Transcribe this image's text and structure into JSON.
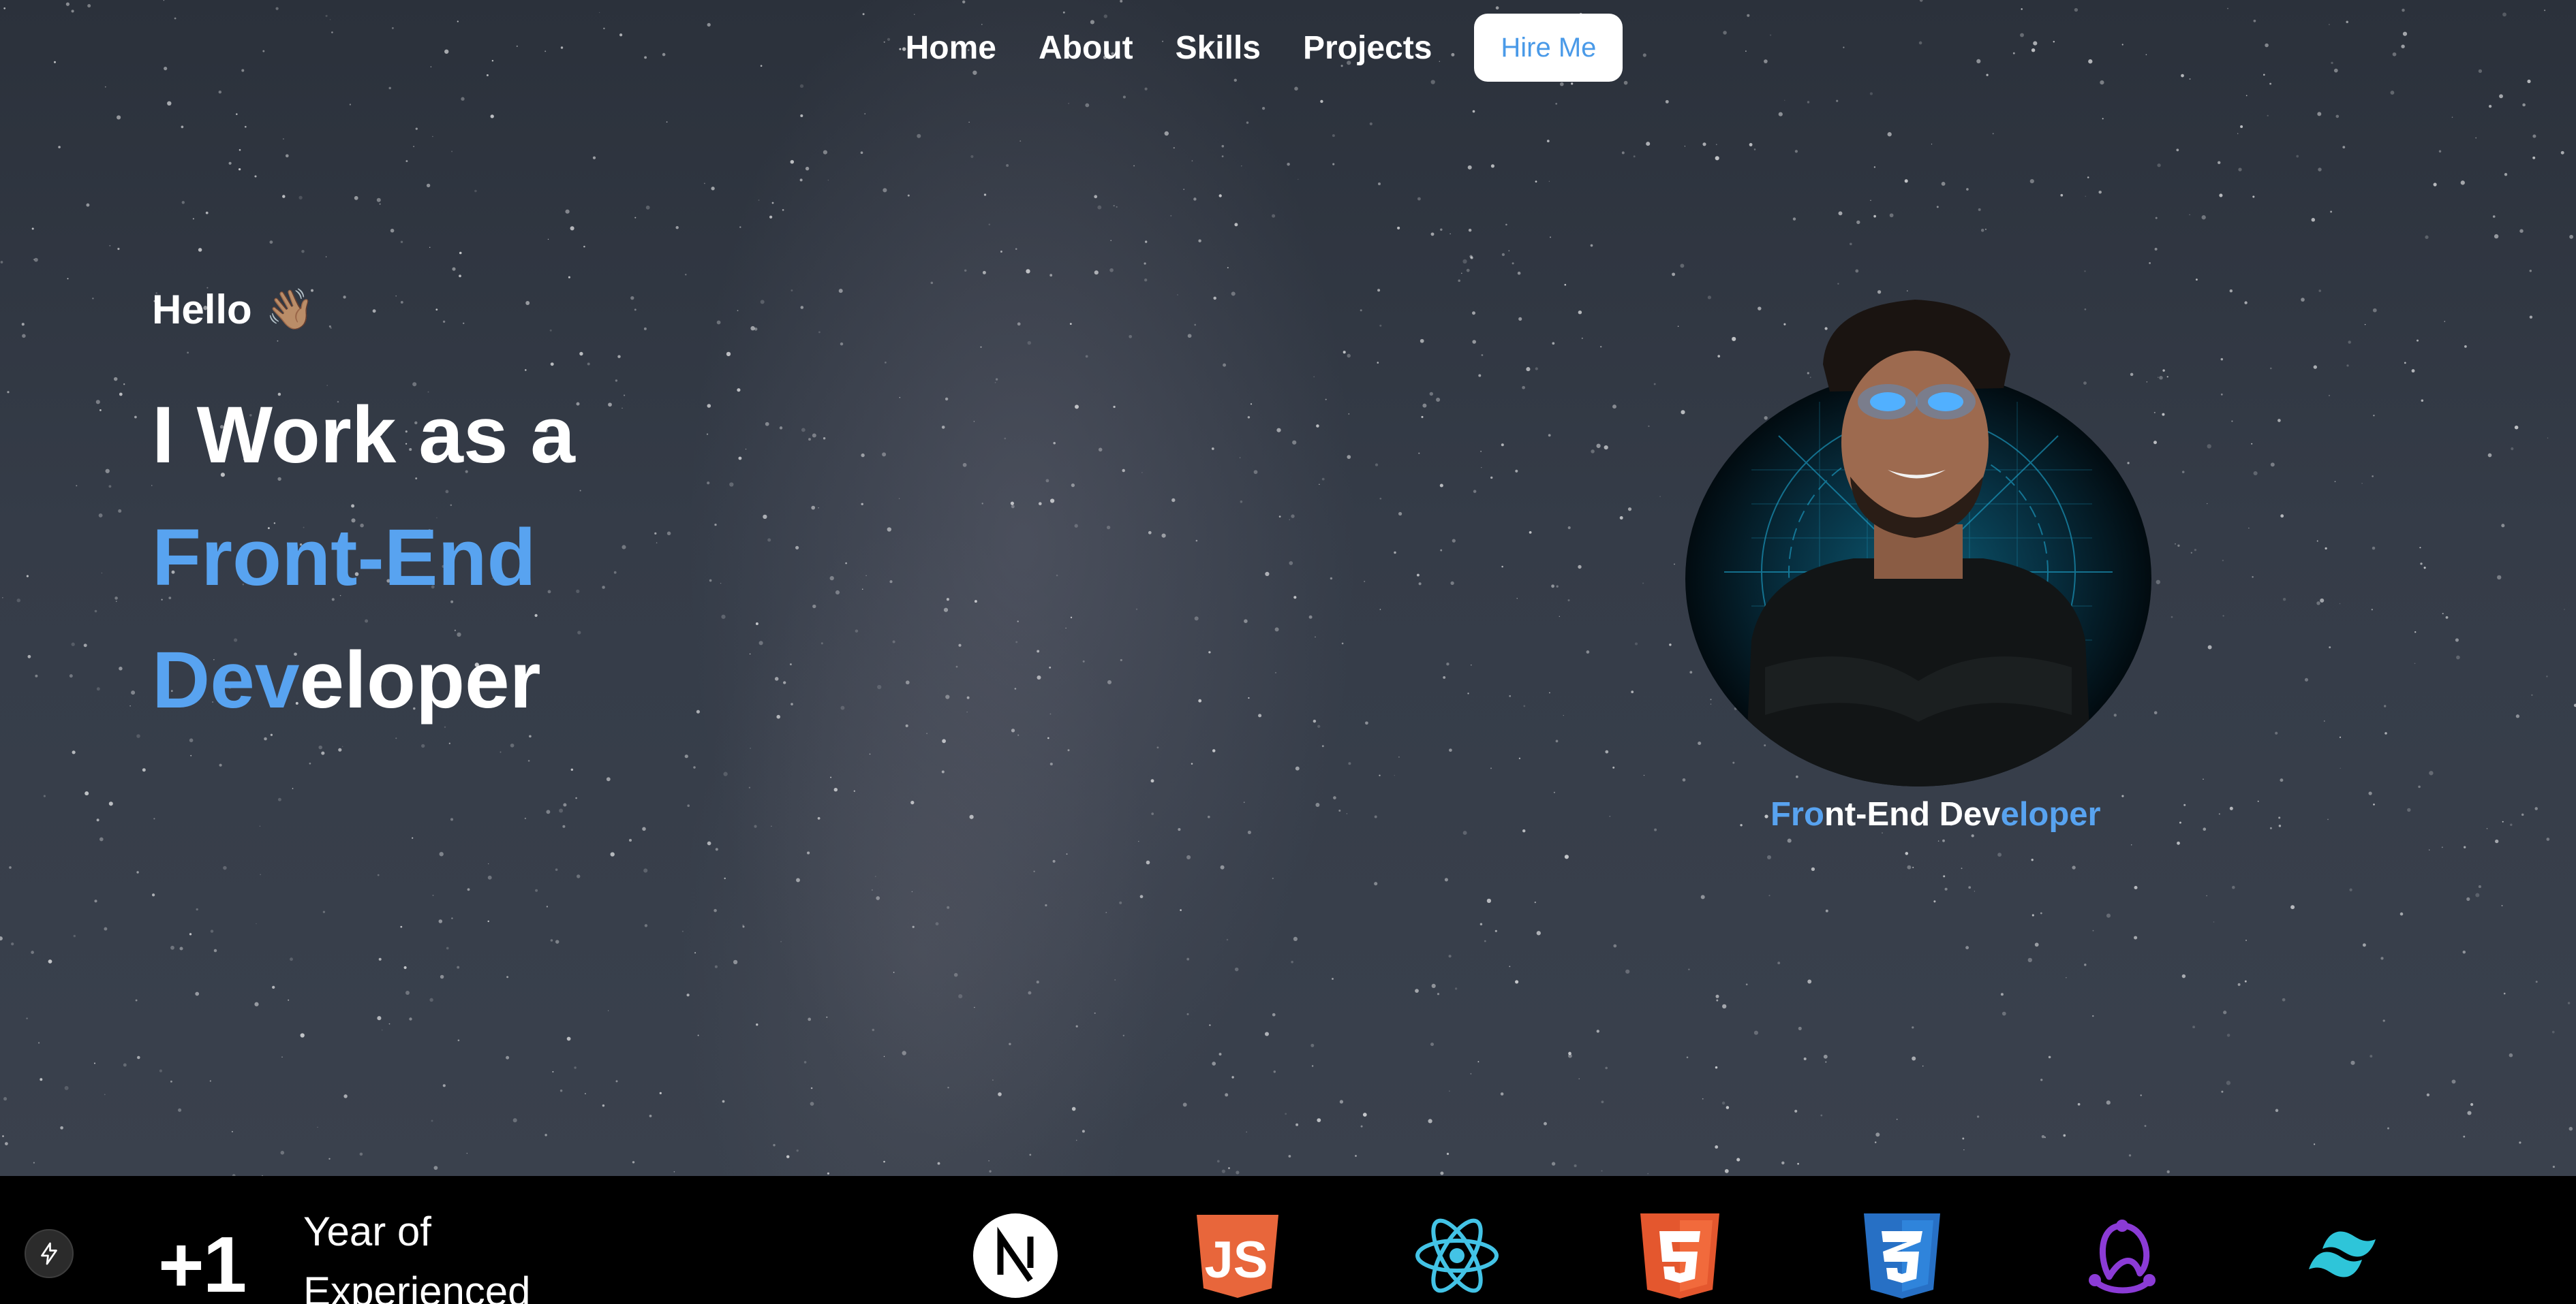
{
  "nav": {
    "links": [
      "Home",
      "About",
      "Skills",
      "Projects"
    ],
    "hire_label": "Hire Me"
  },
  "hero": {
    "greeting": "Hello",
    "greeting_emoji": "👋🏽",
    "headline_line1": "I Work as a",
    "headline_line2": "Front-End",
    "headline_line3_blue": "Dev",
    "headline_line3_white": "eloper"
  },
  "avatar": {
    "caption_part1": "Fro",
    "caption_part2": "nt-End Dev",
    "caption_part3": "eloper"
  },
  "stats": {
    "count": "+1",
    "label_line1": "Year of",
    "label_line2": "Experienced"
  },
  "tech_icons": [
    "nextjs-icon",
    "javascript-icon",
    "react-icon",
    "html5-icon",
    "css3-icon",
    "redux-icon",
    "tailwind-icon"
  ],
  "colors": {
    "accent_blue": "#58a3f0",
    "background": "#2e343f",
    "bar": "#000000"
  }
}
